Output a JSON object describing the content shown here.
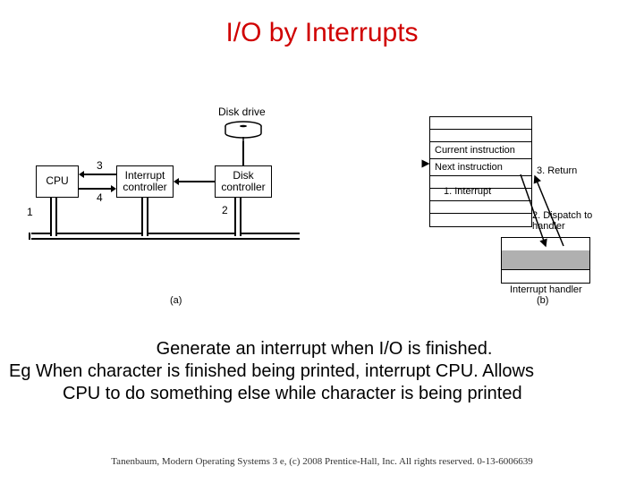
{
  "title": "I/O by Interrupts",
  "left_diagram": {
    "disk_drive_label": "Disk drive",
    "cpu": "CPU",
    "interrupt_controller": "Interrupt controller",
    "disk_controller": "Disk controller",
    "num1": "1",
    "num2": "2",
    "num3": "3",
    "num4": "4",
    "caption": "(a)"
  },
  "right_diagram": {
    "current_instruction": "Current instruction",
    "next_instruction": "Next instruction",
    "step_interrupt": "1. Interrupt",
    "step_dispatch": "2. Dispatch to handler",
    "step_return": "3. Return",
    "handler_label": "Interrupt handler",
    "caption": "(b)"
  },
  "body": {
    "line1": "Generate an interrupt when I/O is finished.",
    "line2": "Eg When character is finished being printed, interrupt CPU. Allows",
    "line3": "CPU to do something else while character is being printed"
  },
  "footer": "Tanenbaum, Modern Operating Systems 3 e, (c) 2008 Prentice-Hall, Inc. All rights reserved. 0-13-6006639"
}
